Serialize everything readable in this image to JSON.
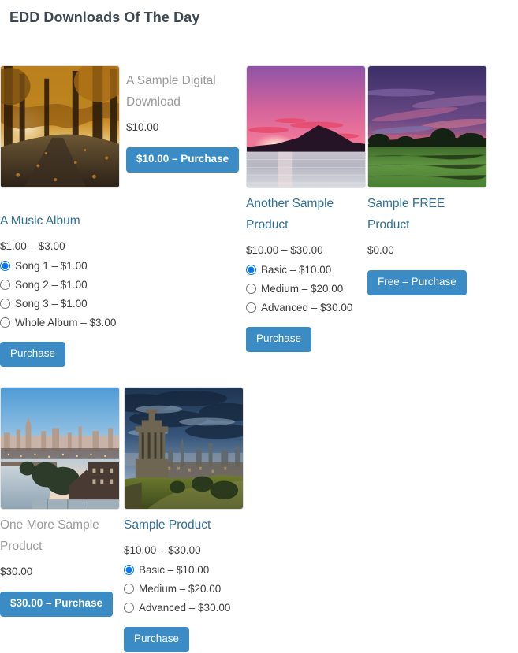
{
  "page": {
    "heading": "EDD Downloads Of The Day"
  },
  "products": [
    {
      "id": "a-sample-digital-download",
      "title": "A Sample Digital Download",
      "title_state": "visited",
      "price": "$10.00",
      "button_label": "$10.00 – Purchase",
      "image_alt": "autumn-forest-road-photo",
      "image_theme": "autumn-road"
    },
    {
      "id": "another-sample-product",
      "title": "Another Sample Product",
      "title_state": "link",
      "price": "$10.00 – $30.00",
      "button_label": "Purchase",
      "image_alt": "pink-sunset-over-lake-photo",
      "image_theme": "pink-sunset-lake",
      "options": [
        {
          "label": "Basic – $10.00",
          "checked": true
        },
        {
          "label": "Medium – $20.00",
          "checked": false
        },
        {
          "label": "Advanced – $30.00",
          "checked": false
        }
      ]
    },
    {
      "id": "sample-free-product",
      "title": "Sample FREE Product",
      "title_state": "link",
      "price": "$0.00",
      "button_label": "Free – Purchase",
      "image_alt": "purple-sunset-over-green-field-photo",
      "image_theme": "purple-field"
    },
    {
      "id": "a-music-album",
      "title": "A Music Album",
      "title_state": "link",
      "price": "$1.00 – $3.00",
      "button_label": "Purchase",
      "options": [
        {
          "label": "Song 1 – $1.00",
          "checked": true
        },
        {
          "label": "Song 2 – $1.00",
          "checked": false
        },
        {
          "label": "Song 3 – $1.00",
          "checked": false
        },
        {
          "label": "Whole Album – $3.00",
          "checked": false
        }
      ]
    },
    {
      "id": "one-more-sample-product",
      "title": "One More Sample Product",
      "title_state": "visited",
      "price": "$30.00",
      "button_label": "$30.00 – Purchase",
      "image_alt": "river-city-skyline-photo",
      "image_theme": "river-city"
    },
    {
      "id": "sample-product",
      "title": "Sample Product",
      "title_state": "link",
      "price": "$10.00 – $30.00",
      "button_label": "Purchase",
      "image_alt": "edinburgh-calton-hill-monument-photo",
      "image_theme": "calton-hill",
      "options": [
        {
          "label": "Basic – $10.00",
          "checked": true
        },
        {
          "label": "Medium – $20.00",
          "checked": false
        },
        {
          "label": "Advanced – $30.00",
          "checked": false
        }
      ]
    }
  ],
  "colors": {
    "accent_button": "#3b8bc4",
    "link": "#2e7098",
    "visited_link": "#9a9a9a",
    "heading": "#3d4852"
  }
}
